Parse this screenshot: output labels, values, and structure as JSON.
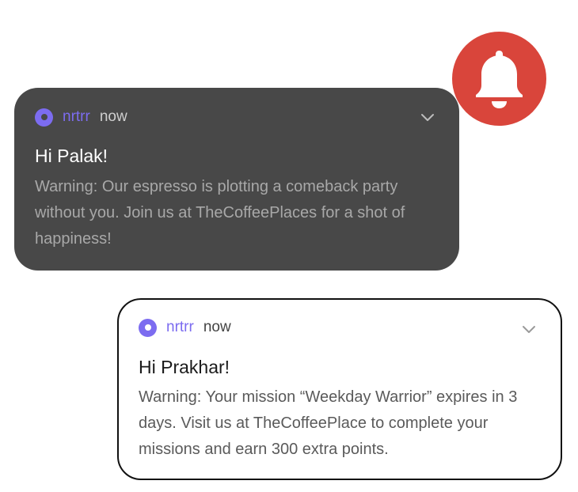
{
  "colors": {
    "accent": "#7c6cf0",
    "bell_badge": "#d9453b",
    "dark_card": "#484848"
  },
  "bell": {
    "icon": "bell-icon"
  },
  "notifications": [
    {
      "theme": "dark",
      "app_name": "nrtrr",
      "time": "now",
      "expand_icon": "chevron-down-icon",
      "title": "Hi Palak!",
      "body": "Warning: Our espresso is plotting a comeback party without you. Join us at TheCoffeePlaces for a shot of happiness!"
    },
    {
      "theme": "light",
      "app_name": "nrtrr",
      "time": "now",
      "expand_icon": "chevron-down-icon",
      "title": "Hi Prakhar!",
      "body": "Warning: Your mission “Weekday Warrior” expires in 3 days. Visit us at TheCoffeePlace to complete your missions and earn 300 extra points."
    }
  ]
}
